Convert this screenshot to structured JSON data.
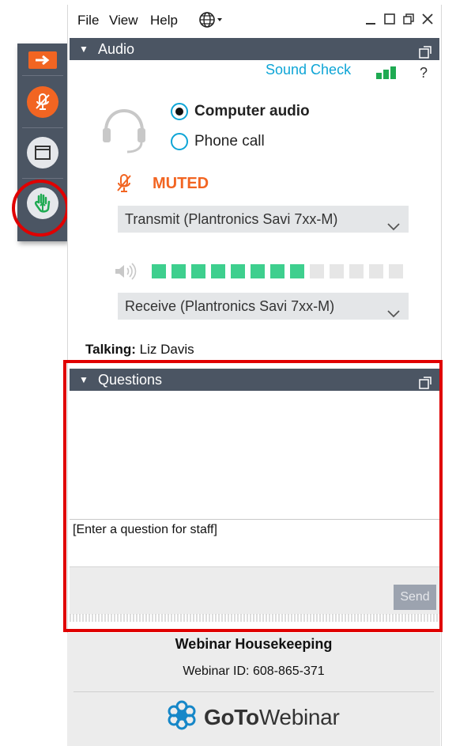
{
  "menu": {
    "file": "File",
    "view": "View",
    "help": "Help"
  },
  "audio": {
    "title": "Audio",
    "sound_check": "Sound Check",
    "help": "?",
    "options": {
      "computer": "Computer audio",
      "phone": "Phone call",
      "selected": "computer"
    },
    "status": "MUTED",
    "transmit_device": "Transmit (Plantronics Savi 7xx-M)",
    "receive_device": "Receive (Plantronics Savi 7xx-M)",
    "volume_level_segments": 8,
    "volume_total_segments": 13,
    "colors": {
      "accent": "#0ea5d6",
      "muted": "#f26522",
      "meter_on": "#3ecf8e",
      "meter_off": "#e6e6e6",
      "header": "#4b5563"
    }
  },
  "talking": {
    "label": "Talking:",
    "name": "Liz Davis"
  },
  "questions": {
    "title": "Questions",
    "placeholder": "[Enter a question for staff]",
    "send": "Send"
  },
  "footer": {
    "title": "Webinar Housekeeping",
    "webinar_id": "Webinar ID: 608-865-371",
    "brand_bold": "GoTo",
    "brand_rest": "Webinar"
  }
}
